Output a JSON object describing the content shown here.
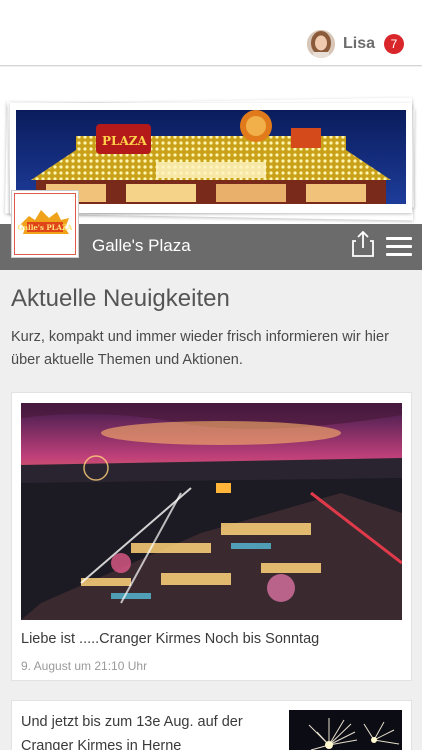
{
  "header": {
    "user_name": "Lisa",
    "notification_count": "7"
  },
  "page": {
    "title": "Galle's Plaza",
    "logo_text": "Galle's PLAZA"
  },
  "banner": {
    "sign_text": "PLAZA"
  },
  "news": {
    "heading": "Aktuelle Neuigkeiten",
    "intro": "Kurz, kompakt und immer wieder frisch informieren wir hier über aktuelle Themen und Aktionen.",
    "items": [
      {
        "title": "Liebe ist .....Cranger Kirmes Noch bis Sonntag",
        "date": "9. August um 21:10 Uhr"
      },
      {
        "title": "Und jetzt bis zum 13e Aug. auf der Cranger Kirmes in Herne"
      }
    ]
  },
  "colors": {
    "titlebar": "#6b6b6b",
    "badge": "#d9262b",
    "background": "#efefef"
  },
  "icons": [
    "avatar",
    "share-icon",
    "menu-icon"
  ]
}
